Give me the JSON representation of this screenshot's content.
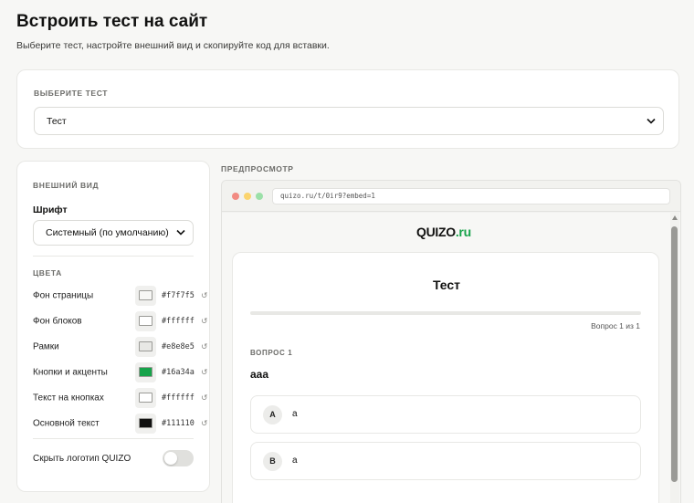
{
  "header": {
    "title": "Встроить тест на сайт",
    "subtitle": "Выберите тест, настройте внешний вид и скопируйте код для вставки."
  },
  "select_test": {
    "label": "ВЫБЕРИТЕ ТЕСТ",
    "selected": "Тест"
  },
  "appearance": {
    "label": "ВНЕШНИЙ ВИД",
    "font_label": "Шрифт",
    "font_selected": "Системный (по умолчанию)",
    "colors_label": "ЦВЕТА",
    "colors": [
      {
        "name": "Фон страницы",
        "hex": "#f7f7f5"
      },
      {
        "name": "Фон блоков",
        "hex": "#ffffff"
      },
      {
        "name": "Рамки",
        "hex": "#e8e8e5"
      },
      {
        "name": "Кнопки и акценты",
        "hex": "#16a34a"
      },
      {
        "name": "Текст на кнопках",
        "hex": "#ffffff"
      },
      {
        "name": "Основной текст",
        "hex": "#111110"
      }
    ],
    "reset_icon": "↺",
    "hide_logo_label": "Скрыть логотип QUIZO",
    "hide_logo_on": false
  },
  "preview": {
    "label": "ПРЕДПРОСМОТР",
    "url": "quizo.ru/t/0ir9?embed=1",
    "brand_main": "QUIZO",
    "brand_suffix": ".ru",
    "quiz_title": "Тест",
    "progress": "Вопрос 1 из 1",
    "progress_fraction": 0,
    "question_label": "ВОПРОС 1",
    "question_text": "aaa",
    "answers": [
      {
        "letter": "A",
        "text": "a"
      },
      {
        "letter": "B",
        "text": "a"
      }
    ]
  }
}
